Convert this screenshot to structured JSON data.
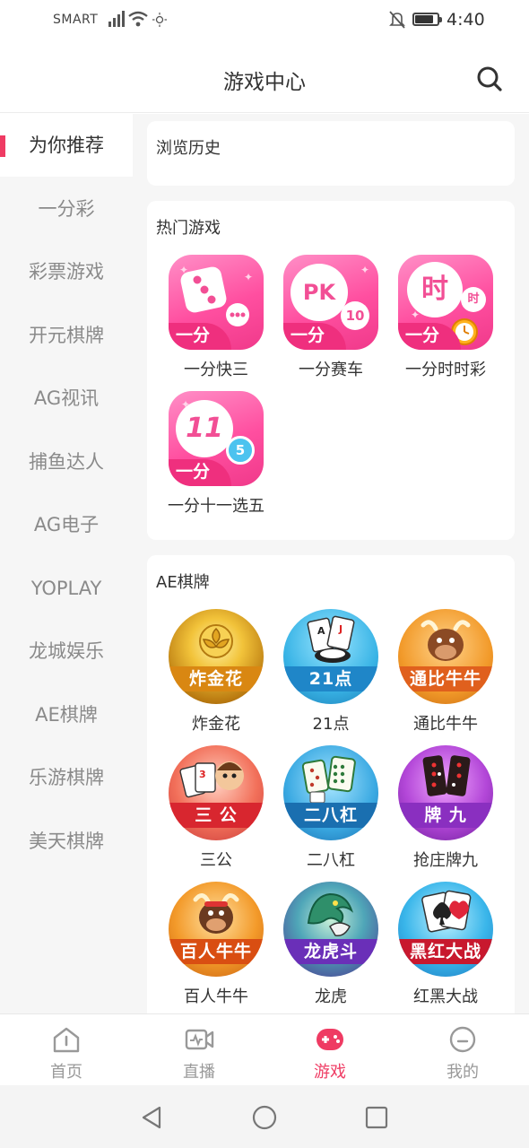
{
  "status": {
    "carrier": "SMART",
    "time": "4:40"
  },
  "header": {
    "title": "游戏中心"
  },
  "sidebar": {
    "items": [
      {
        "label": "为你推荐",
        "active": true
      },
      {
        "label": "一分彩"
      },
      {
        "label": "彩票游戏"
      },
      {
        "label": "开元棋牌"
      },
      {
        "label": "AG视讯"
      },
      {
        "label": "捕鱼达人"
      },
      {
        "label": "AG电子"
      },
      {
        "label": "YOPLAY"
      },
      {
        "label": "龙城娱乐"
      },
      {
        "label": "AE棋牌"
      },
      {
        "label": "乐游棋牌"
      },
      {
        "label": "美天棋牌"
      }
    ]
  },
  "history": {
    "title": "浏览历史"
  },
  "hot": {
    "title": "热门游戏",
    "badge": "一分",
    "games": [
      {
        "label": "一分快三",
        "icon": "dice-icon"
      },
      {
        "label": "一分赛车",
        "icon": "pk10-icon",
        "glyph": "PK",
        "sub": "10"
      },
      {
        "label": "一分时时彩",
        "icon": "shishi-clock-icon",
        "glyph": "时",
        "sub": "时"
      },
      {
        "label": "一分十一选五",
        "icon": "eleven-pick-five-icon",
        "glyph": "11",
        "sub": "5"
      }
    ]
  },
  "ae": {
    "title": "AE棋牌",
    "games": [
      {
        "label": "炸金花",
        "banner": "炸金花",
        "icon": "golden-rose-icon",
        "color": "#e6a51e"
      },
      {
        "label": "21点",
        "banner": "21点",
        "icon": "blackjack-cards-icon",
        "color": "#3fb3e0"
      },
      {
        "label": "通比牛牛",
        "banner": "通比牛牛",
        "icon": "bull-icon",
        "color": "#f29a2a"
      },
      {
        "label": "三公",
        "banner": "三 公",
        "icon": "cards-king-icon",
        "color": "#e8474a"
      },
      {
        "label": "二八杠",
        "banner": "二八杠",
        "icon": "mahjong-tiles-icon",
        "color": "#2e9fd8"
      },
      {
        "label": "抢庄牌九",
        "banner": "牌 九",
        "icon": "paigow-domino-icon",
        "color": "#9b3fd0"
      },
      {
        "label": "百人牛牛",
        "banner": "百人牛牛",
        "icon": "bull-warrior-icon",
        "color": "#f08a1e"
      },
      {
        "label": "龙虎",
        "banner": "龙虎斗",
        "icon": "dragon-tiger-icon",
        "color": "#7a4fd6"
      },
      {
        "label": "红黑大战",
        "banner": "黑红大战",
        "icon": "poker-spade-icon",
        "color": "#3aa8e8"
      }
    ]
  },
  "nav": {
    "items": [
      {
        "label": "首页",
        "icon": "home-icon"
      },
      {
        "label": "直播",
        "icon": "live-video-icon"
      },
      {
        "label": "游戏",
        "icon": "gamepad-icon",
        "active": true
      },
      {
        "label": "我的",
        "icon": "profile-icon"
      }
    ]
  },
  "colors": {
    "accent": "#ef3b63",
    "lottery_pink": "#ff4fa0",
    "sidebar_bg": "#f6f6f6"
  }
}
